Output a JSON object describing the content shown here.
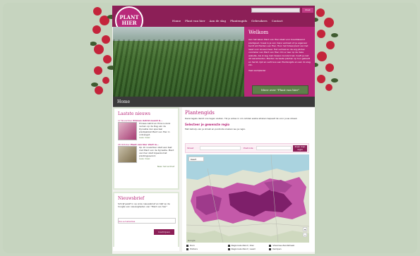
{
  "site": {
    "logo_text": "PLANT HIER",
    "search_button": "Zoek"
  },
  "nav": {
    "items": [
      "Home",
      "Plant van hier",
      "Aan de slag",
      "Plantengids",
      "Gebruikers",
      "Contact"
    ]
  },
  "welcome": {
    "title": "Welkom",
    "body": "Aan het leben Plant van Hier staat voor boeddeleand plantgoed, hoeel is je van mare verkiest uit je eigenaar berrit wil Planten van Hier. Hoor het totaal plant van het laast voor zoveel meer. Het verhaal en de erg plinten voorlader van Plant van Hier. Om er leer op de deze website. Als ik zeg met mission bonde trost, hoeft je niet dit aanerbieden. Planten de beste planten op hun gebiedt en herrst, lijst en vertrouw een Plantengids en aan do slag zzn.",
    "sign": "Veel werkplezier",
    "cta": "Meer over \"Plant van hier\""
  },
  "breadcrumb": {
    "label": "Home"
  },
  "news": {
    "title": "Laatste nieuws",
    "items": [
      {
        "date": "17 November",
        "headline": "Prinses Astrid neemt b...",
        "body": "Prinses Astrid en Prins Lorenz nemen op de Dag van de Dynastie den speciaal plantpakket Plant van Hier in ontvangst.",
        "more": "Lees meer"
      },
      {
        "date": "28 Oktober",
        "headline": "Plant van hier start m...",
        "body": "Op 10 november start een test met Plant van de Dynastie. Plant van hier start bijeenkomst plantingsavond.",
        "more": "Lees meer"
      }
    ],
    "archive": "Naar het archief"
  },
  "newsletter": {
    "title": "Nieuwsbrief",
    "desc": "Schrijf jezelf in op onze nieuwsbrief en blijf op de hoogte van nieuwigheden van \"Plant van hier\"",
    "email_label": "Uw e-mailadres",
    "email_placeholder": "",
    "button": "Inschrijven"
  },
  "plantengids": {
    "title": "Plantengids",
    "intro": "Deze tegels dankt ons tegen sluiten. Tik je adres in om ontdek welke streken bepaalt de voor jouw streek.",
    "subheading": "Selecteer je gewenste regio",
    "hint": "Met behulp van je straat en postcode zoeken we je regio.",
    "filter": {
      "street_label": "Straat",
      "postcode_label": "Postcode",
      "button": "Zoek mijn regio"
    },
    "map": {
      "type_select": "Kaart",
      "zoom_in": "+",
      "zoom_out": "−",
      "credit": "Google"
    },
    "legend": [
      "Duin",
      "Regionale Zand / Klei",
      "Vlaamse Zandstreek",
      "Polders",
      "Regionale Zand / Leem",
      "Kempen"
    ]
  }
}
